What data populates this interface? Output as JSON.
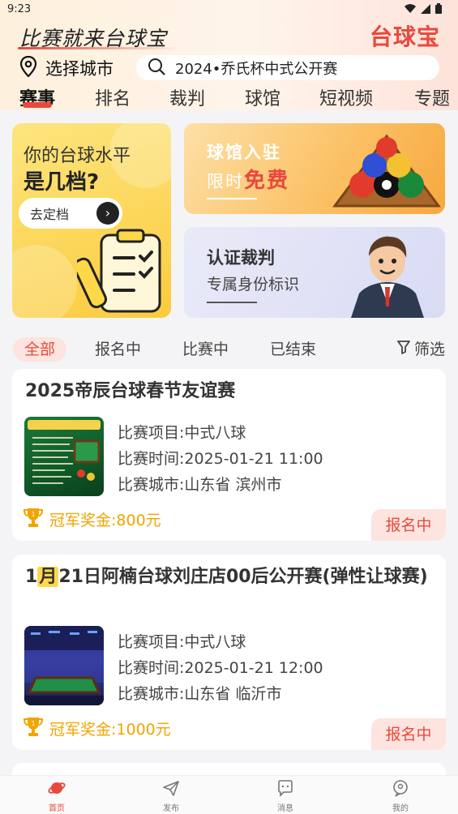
{
  "status": {
    "time": "9:23"
  },
  "header": {
    "slogan": "比赛就来台球宝",
    "brand": "台球宝",
    "city_label": "选择城市",
    "search_text": "2024•乔氏杯中式公开赛"
  },
  "tabs": [
    "赛事",
    "排名",
    "裁判",
    "球馆",
    "短视频",
    "专题"
  ],
  "banners": {
    "level": {
      "line1": "你的台球水平",
      "line2": "是几档?",
      "button": "去定档"
    },
    "venue": {
      "line1": "球馆入驻",
      "line2_prefix": "限时",
      "line2_highlight": "免费"
    },
    "referee": {
      "line1": "认证裁判",
      "line2": "专属身份标识"
    }
  },
  "filters": {
    "chips": [
      "全部",
      "报名中",
      "比赛中",
      "已结束"
    ],
    "filter_label": "筛选"
  },
  "events": [
    {
      "title": "2025帝辰台球春节友谊赛",
      "project": "比赛项目:中式八球",
      "time": "比赛时间:2025-01-21 11:00",
      "city": "比赛城市:山东省 滨州市",
      "prize": "冠军奖金:800元",
      "status": "报名中"
    },
    {
      "title_pre": "1",
      "title_hl": "月",
      "title_post": "21日阿楠台球刘庄店00后公开赛(弹性让球赛)",
      "project": "比赛项目:中式八球",
      "time": "比赛时间:2025-01-21 12:00",
      "city": "比赛城市:山东省 临沂市",
      "prize": "冠军奖金:1000元",
      "status": "报名中"
    }
  ],
  "bottom_nav": [
    "首页",
    "发布",
    "消息",
    "我的"
  ],
  "colors": {
    "accent": "#e9483d",
    "gold": "#f2a400"
  }
}
